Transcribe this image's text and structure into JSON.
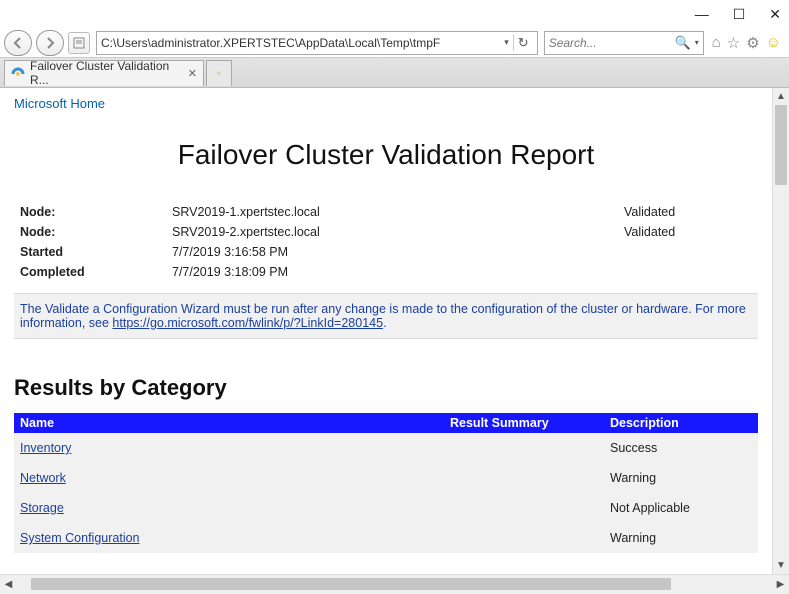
{
  "window": {
    "minimize": "—",
    "maximize": "☐",
    "close": "✕"
  },
  "toolbar": {
    "address": "C:\\Users\\administrator.XPERTSTEC\\AppData\\Local\\Temp\\tmpF",
    "search_placeholder": "Search...",
    "icons": {
      "home": "⌂",
      "star": "☆",
      "gear": "⚙",
      "smile": "☺"
    }
  },
  "tabs": {
    "active": {
      "title": "Failover Cluster Validation R...",
      "close": "✕"
    }
  },
  "header": {
    "ms_home": "Microsoft Home"
  },
  "report": {
    "title": "Failover Cluster Validation Report",
    "rows": [
      {
        "label": "Node:",
        "value": "SRV2019-1.xpertstec.local",
        "status": "Validated"
      },
      {
        "label": "Node:",
        "value": "SRV2019-2.xpertstec.local",
        "status": "Validated"
      },
      {
        "label": "Started",
        "value": "7/7/2019 3:16:58 PM",
        "status": ""
      },
      {
        "label": "Completed",
        "value": "7/7/2019 3:18:09 PM",
        "status": ""
      }
    ],
    "notice_prefix": "The Validate a Configuration Wizard must be run after any change is made to the configuration of the cluster or hardware. For more information, see ",
    "notice_link": "https://go.microsoft.com/fwlink/p/?LinkId=280145",
    "notice_suffix": "."
  },
  "results": {
    "heading": "Results by Category",
    "cols": {
      "name": "Name",
      "summary": "Result Summary",
      "desc": "Description"
    },
    "rows": [
      {
        "name": "Inventory",
        "summary": "",
        "desc": "Success"
      },
      {
        "name": "Network",
        "summary": "",
        "desc": "Warning"
      },
      {
        "name": "Storage",
        "summary": "",
        "desc": "Not Applicable"
      },
      {
        "name": "System Configuration",
        "summary": "",
        "desc": "Warning"
      }
    ]
  }
}
